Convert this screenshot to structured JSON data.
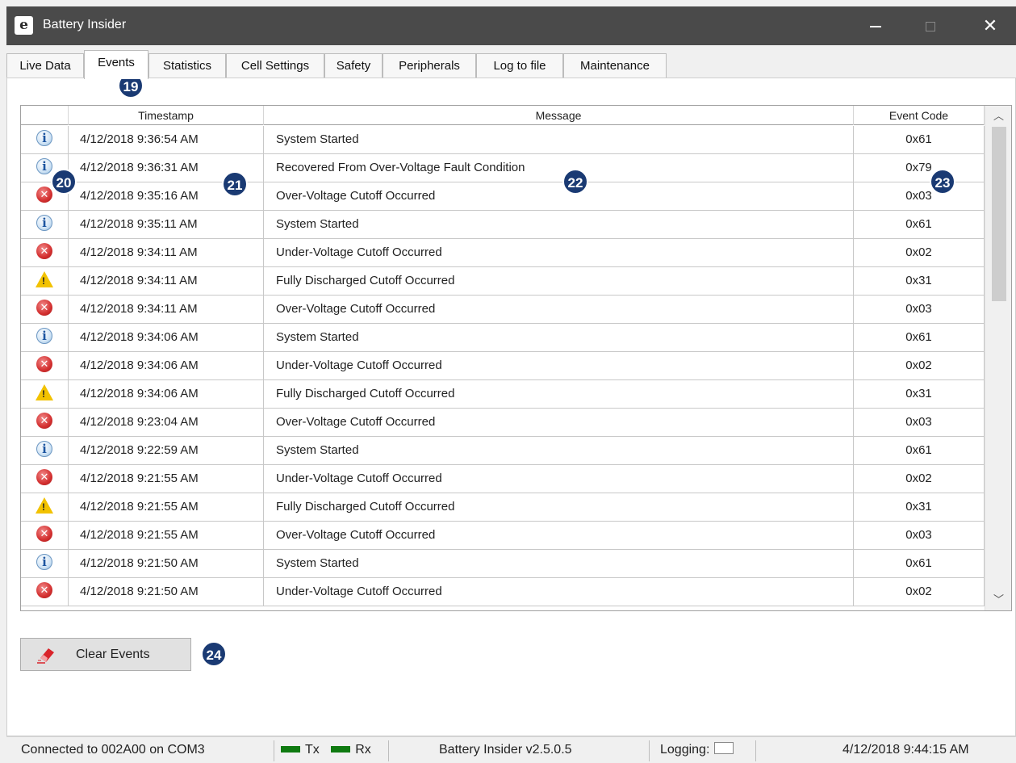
{
  "window": {
    "title": "Battery Insider",
    "app_icon": "e-logo-icon",
    "min_glyph": "",
    "close_glyph": "✕"
  },
  "tabs": [
    {
      "label": "Live Data"
    },
    {
      "label": "Events",
      "active": true
    },
    {
      "label": "Statistics"
    },
    {
      "label": "Cell Settings"
    },
    {
      "label": "Safety"
    },
    {
      "label": "Peripherals"
    },
    {
      "label": "Log to file"
    },
    {
      "label": "Maintenance"
    }
  ],
  "grid": {
    "columns": [
      "",
      "Timestamp",
      "Message",
      "Event Code"
    ],
    "rows": [
      {
        "icon": "info",
        "timestamp": "4/12/2018 9:36:54 AM",
        "message": "System Started",
        "code": "0x61"
      },
      {
        "icon": "info",
        "timestamp": "4/12/2018 9:36:31 AM",
        "message": "Recovered From Over-Voltage Fault Condition",
        "code": "0x79"
      },
      {
        "icon": "error",
        "timestamp": "4/12/2018 9:35:16 AM",
        "message": "Over-Voltage Cutoff Occurred",
        "code": "0x03"
      },
      {
        "icon": "info",
        "timestamp": "4/12/2018 9:35:11 AM",
        "message": "System Started",
        "code": "0x61"
      },
      {
        "icon": "error",
        "timestamp": "4/12/2018 9:34:11 AM",
        "message": "Under-Voltage Cutoff Occurred",
        "code": "0x02"
      },
      {
        "icon": "warning",
        "timestamp": "4/12/2018 9:34:11 AM",
        "message": "Fully Discharged Cutoff Occurred",
        "code": "0x31"
      },
      {
        "icon": "error",
        "timestamp": "4/12/2018 9:34:11 AM",
        "message": "Over-Voltage Cutoff Occurred",
        "code": "0x03"
      },
      {
        "icon": "info",
        "timestamp": "4/12/2018 9:34:06 AM",
        "message": "System Started",
        "code": "0x61"
      },
      {
        "icon": "error",
        "timestamp": "4/12/2018 9:34:06 AM",
        "message": "Under-Voltage Cutoff Occurred",
        "code": "0x02"
      },
      {
        "icon": "warning",
        "timestamp": "4/12/2018 9:34:06 AM",
        "message": "Fully Discharged Cutoff Occurred",
        "code": "0x31"
      },
      {
        "icon": "error",
        "timestamp": "4/12/2018 9:23:04 AM",
        "message": "Over-Voltage Cutoff Occurred",
        "code": "0x03"
      },
      {
        "icon": "info",
        "timestamp": "4/12/2018 9:22:59 AM",
        "message": "System Started",
        "code": "0x61"
      },
      {
        "icon": "error",
        "timestamp": "4/12/2018 9:21:55 AM",
        "message": "Under-Voltage Cutoff Occurred",
        "code": "0x02"
      },
      {
        "icon": "warning",
        "timestamp": "4/12/2018 9:21:55 AM",
        "message": "Fully Discharged Cutoff Occurred",
        "code": "0x31"
      },
      {
        "icon": "error",
        "timestamp": "4/12/2018 9:21:55 AM",
        "message": "Over-Voltage Cutoff Occurred",
        "code": "0x03"
      },
      {
        "icon": "info",
        "timestamp": "4/12/2018 9:21:50 AM",
        "message": "System Started",
        "code": "0x61"
      },
      {
        "icon": "error",
        "timestamp": "4/12/2018 9:21:50 AM",
        "message": "Under-Voltage Cutoff Occurred",
        "code": "0x02"
      }
    ]
  },
  "actions": {
    "clear_label": "Clear Events",
    "clear_icon": "eraser-icon"
  },
  "callouts": [
    "19",
    "20",
    "21",
    "22",
    "23",
    "24"
  ],
  "status": {
    "connection": "Connected to 002A00 on COM3",
    "tx_label": "Tx",
    "rx_label": "Rx",
    "version": "Battery Insider v2.5.0.5",
    "logging_label": "Logging:",
    "datetime": "4/12/2018 9:44:15 AM"
  },
  "colors": {
    "titlebar": "#4a4a4a",
    "callout": "#1a3a73",
    "led_on": "#0f7a10",
    "error": "#d32f2f",
    "warning": "#f2c200",
    "info": "#1d55a0"
  }
}
